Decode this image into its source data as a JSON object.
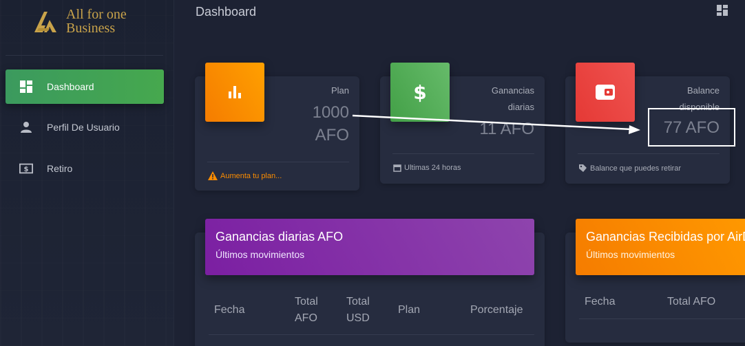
{
  "brand": {
    "line1": "All for one",
    "line2": "Business",
    "color": "#c9a34a"
  },
  "sidebar": {
    "items": [
      {
        "label": "Dashboard",
        "icon": "dashboard-icon",
        "active": true
      },
      {
        "label": "Perfil De Usuario",
        "icon": "person-icon",
        "active": false
      },
      {
        "label": "Retiro",
        "icon": "money-icon",
        "active": false
      }
    ]
  },
  "header": {
    "title": "Dashboard",
    "apps_icon": "apps-icon"
  },
  "stats": [
    {
      "category": "Plan",
      "value_line1": "1000",
      "value_line2": "AFO",
      "footer": "Aumenta tu plan...",
      "icon": "bar-chart-icon",
      "color": "#fb8c00",
      "footer_icon": "warning-icon"
    },
    {
      "category_line1": "Ganancias",
      "category_line2": "diarias",
      "value": "11 AFO",
      "footer": "Ultimas 24 horas",
      "icon": "dollar-icon",
      "color": "#43a047",
      "footer_icon": "calendar-icon"
    },
    {
      "category_line1": "Balance",
      "category_line2": "disponible",
      "value": "77 AFO",
      "footer": "Balance que puedes retirar",
      "icon": "wallet-icon",
      "color": "#e53935",
      "footer_icon": "tag-icon"
    }
  ],
  "panels": [
    {
      "title": "Ganancias diarias AFO",
      "subtitle": "Últimos movimientos",
      "color": "#8e24aa",
      "columns": [
        "Fecha",
        "Total AFO",
        "Total USD",
        "Plan",
        "Porcentaje"
      ]
    },
    {
      "title": "Ganancias Recibidas por AirD",
      "subtitle": "Últimos movimientos",
      "color": "#fb8c00",
      "columns": [
        "Fecha",
        "Total AFO"
      ]
    }
  ]
}
